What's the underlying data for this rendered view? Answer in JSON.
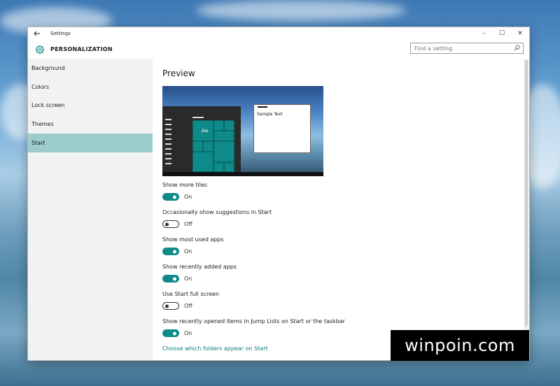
{
  "window": {
    "title": "Settings",
    "controls": {
      "minimize": "–",
      "maximize": "☐",
      "close": "✕"
    }
  },
  "header": {
    "title": "PERSONALIZATION",
    "search_placeholder": "Find a setting"
  },
  "sidebar": {
    "items": [
      {
        "label": "Background",
        "active": false
      },
      {
        "label": "Colors",
        "active": false
      },
      {
        "label": "Lock screen",
        "active": false
      },
      {
        "label": "Themes",
        "active": false
      },
      {
        "label": "Start",
        "active": true
      }
    ]
  },
  "main": {
    "preview_title": "Preview",
    "preview_sample_text": "Sample Text",
    "preview_tile_label": "Aa",
    "settings": [
      {
        "label": "Show more tiles",
        "state": "On",
        "on": true
      },
      {
        "label": "Occasionally show suggestions in Start",
        "state": "Off",
        "on": false
      },
      {
        "label": "Show most used apps",
        "state": "On",
        "on": true
      },
      {
        "label": "Show recently added apps",
        "state": "On",
        "on": true
      },
      {
        "label": "Use Start full screen",
        "state": "Off",
        "on": false
      },
      {
        "label": "Show recently opened items in Jump Lists on Start or the taskbar",
        "state": "On",
        "on": true
      }
    ],
    "link": "Choose which folders appear on Start"
  },
  "watermark": "winpoin.com",
  "colors": {
    "accent": "#0f8a8a",
    "sidebar_active": "#9ccccc",
    "link": "#0f7a7a"
  },
  "icons": {
    "back": "back-arrow-icon",
    "gear": "gear-icon",
    "search": "search-icon"
  }
}
